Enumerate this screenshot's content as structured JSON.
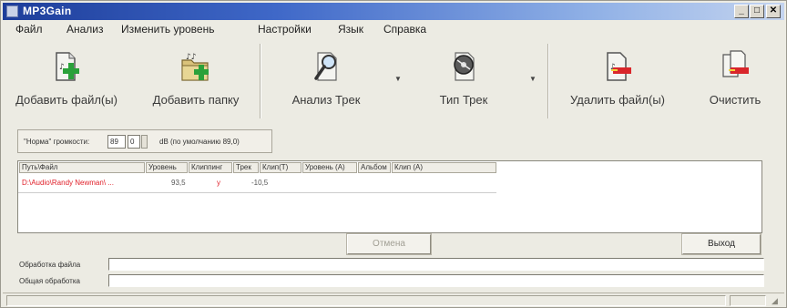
{
  "window": {
    "title": "MP3Gain"
  },
  "menu": [
    "Файл",
    "Анализ",
    "Изменить уровень",
    "Настройки",
    "Язык",
    "Справка"
  ],
  "toolbar": {
    "add_files": "Добавить файл(ы)",
    "add_folder": "Добавить папку",
    "analyze_track": "Анализ Трек",
    "gain_track": "Тип Трек",
    "remove_files": "Удалить файл(ы)",
    "clear": "Очистить"
  },
  "normal_volume": {
    "label": "\"Норма\" громкости:",
    "value_int": "89",
    "value_dec": "0",
    "suffix": "dB (по умолчанию 89,0)"
  },
  "table": {
    "columns": [
      "Путь\\Файл",
      "Уровень",
      "Клиппинг",
      "Трек",
      "Клип(Т)",
      "Уровень (А)",
      "Альбом",
      "Клип (А)"
    ],
    "rows": [
      {
        "path": "D:\\Audio\\Randy Newman\\ ...",
        "volume": "93,5",
        "clipping": "y",
        "track": "-10,5"
      }
    ]
  },
  "buttons": {
    "cancel": "Отмена",
    "exit": "Выход"
  },
  "progress": {
    "file_label": "Обработка файла",
    "total_label": "Общая обработка"
  }
}
